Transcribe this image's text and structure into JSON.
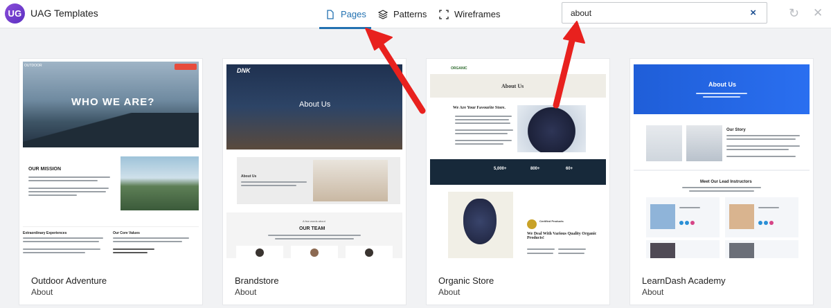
{
  "app": {
    "logo_text": "UG",
    "title": "UAG Templates"
  },
  "tabs": [
    {
      "label": "Pages",
      "active": true,
      "icon": "page-icon"
    },
    {
      "label": "Patterns",
      "active": false,
      "icon": "layers-icon"
    },
    {
      "label": "Wireframes",
      "active": false,
      "icon": "frame-corners-icon"
    }
  ],
  "search": {
    "value": "about",
    "clear_icon": "×"
  },
  "controls": {
    "refresh_icon": "↻",
    "close_icon": "✕"
  },
  "templates": [
    {
      "name": "Outdoor Adventure",
      "type": "About",
      "preview": {
        "logo": "OUTDOOR",
        "hero_title": "WHO WE ARE?",
        "section": "OUR MISSION",
        "col1": "Extraordinary Experiences",
        "col2": "Our Core Values"
      }
    },
    {
      "name": "Brandstore",
      "type": "About",
      "preview": {
        "logo": "DNK",
        "hero_title": "About Us",
        "section": "About Us",
        "team_kicker": "A few words about",
        "team_title": "OUR TEAM"
      }
    },
    {
      "name": "Organic Store",
      "type": "About",
      "preview": {
        "logo": "ORGANIC",
        "hero_title": "About Us",
        "heading": "We Are Your Favourite Store.",
        "stat1": "5,000+",
        "stat2": "800+",
        "stat3": "60+",
        "badge": "Certified Products",
        "heading2": "We Deal With Various Quality Organic Products!"
      }
    },
    {
      "name": "LearnDash Academy",
      "type": "About",
      "preview": {
        "hero_title": "About Us",
        "section": "Our Story",
        "lead_title": "Meet Our Lead Instructors"
      }
    }
  ],
  "colors": {
    "accent": "#2271b1",
    "annotation_arrow": "#e8211e",
    "logo_purple": "#6a38cc"
  }
}
